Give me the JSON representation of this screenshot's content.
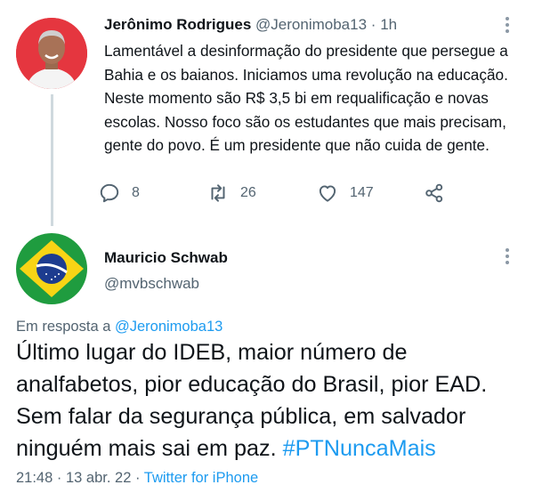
{
  "tweet1": {
    "name": "Jerônimo Rodrigues",
    "handle": "@Jeronimoba13",
    "separator": "·",
    "time": "1h",
    "text": "Lamentável a desinformação do presidente que persegue a Bahia e os baianos. Iniciamos uma revolução na educação. Neste momento são R$ 3,5 bi em requalificação e novas escolas. Nosso foco são os estudantes que mais precisam, gente do povo. É um presidente que não cuida de gente.",
    "replies": "8",
    "retweets": "26",
    "likes": "147",
    "icons": {
      "reply": "reply-icon",
      "retweet": "retweet-icon",
      "like": "heart-icon",
      "share": "share-icon",
      "more": "more-icon"
    }
  },
  "tweet2": {
    "name": "Mauricio Schwab",
    "handle": "@mvbschwab",
    "reply_prefix": "Em resposta a",
    "reply_handle": "@Jeronimoba13",
    "text": "Último lugar do IDEB, maior número de analfabetos, pior educação do Brasil, pior EAD. Sem falar da segurança pública, em salvador ninguém mais sai em paz.",
    "hashtag": "#PTNuncaMais",
    "time": "21:48",
    "separator": "·",
    "date": "13 abr. 22",
    "source": "Twitter for iPhone"
  },
  "colors": {
    "accent": "#1d9bf0",
    "text": "#0f1419",
    "secondary": "#536471",
    "avatar1_bg": "#e5363f",
    "flag_green": "#1f9c3f",
    "flag_yellow": "#f8d415",
    "flag_blue": "#1d3c8f"
  }
}
